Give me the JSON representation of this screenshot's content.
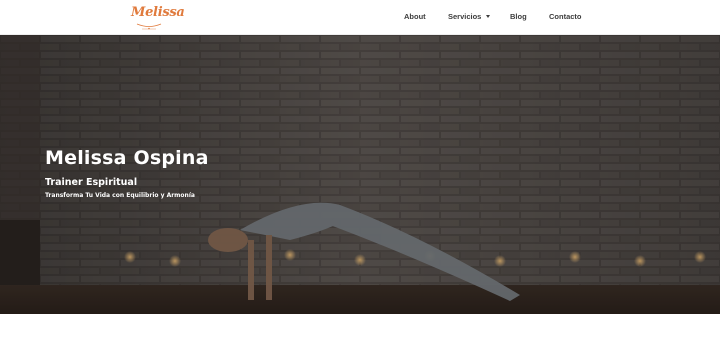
{
  "header": {
    "logo_text": "Melissa",
    "nav": {
      "about": "About",
      "servicios": "Servicios",
      "blog": "Blog",
      "contacto": "Contacto"
    }
  },
  "hero": {
    "title": "Melissa Ospina",
    "subtitle": "Trainer Espiritual",
    "tagline": "Transforma Tu Vida con Equilibrio y Armonía"
  },
  "colors": {
    "brand_orange": "#e07a3c",
    "nav_text": "#3d3d3d",
    "hero_text": "#ffffff",
    "hero_overlay": "#2a2522"
  },
  "icons": {
    "logo": "melissa-logo-icon",
    "servicios_caret": "caret-down-icon"
  }
}
